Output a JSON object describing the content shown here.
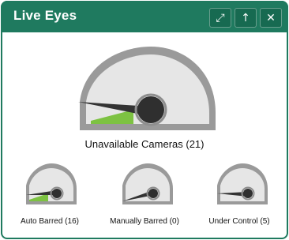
{
  "widget": {
    "title": "Live Eyes",
    "buttons": {
      "expand_icon": "expand-icon",
      "up_icon": "arrow-up-icon",
      "close_icon": "close-icon",
      "expand_glyph": "⤢",
      "up_glyph": "↑",
      "close_glyph": "✕"
    },
    "colors": {
      "frame": "#1f7a5f",
      "gauge_outline": "#9a9a9a",
      "gauge_fill": "#e5e5e5",
      "needle": "#2f2f2f",
      "accent_green": "#7dc242"
    }
  },
  "gauges": {
    "main": {
      "label": "Unavailable Cameras (21)"
    },
    "small": [
      {
        "label": "Auto Barred (16)"
      },
      {
        "label": "Manually Barred (0)"
      },
      {
        "label": "Under Control (5)"
      }
    ]
  }
}
